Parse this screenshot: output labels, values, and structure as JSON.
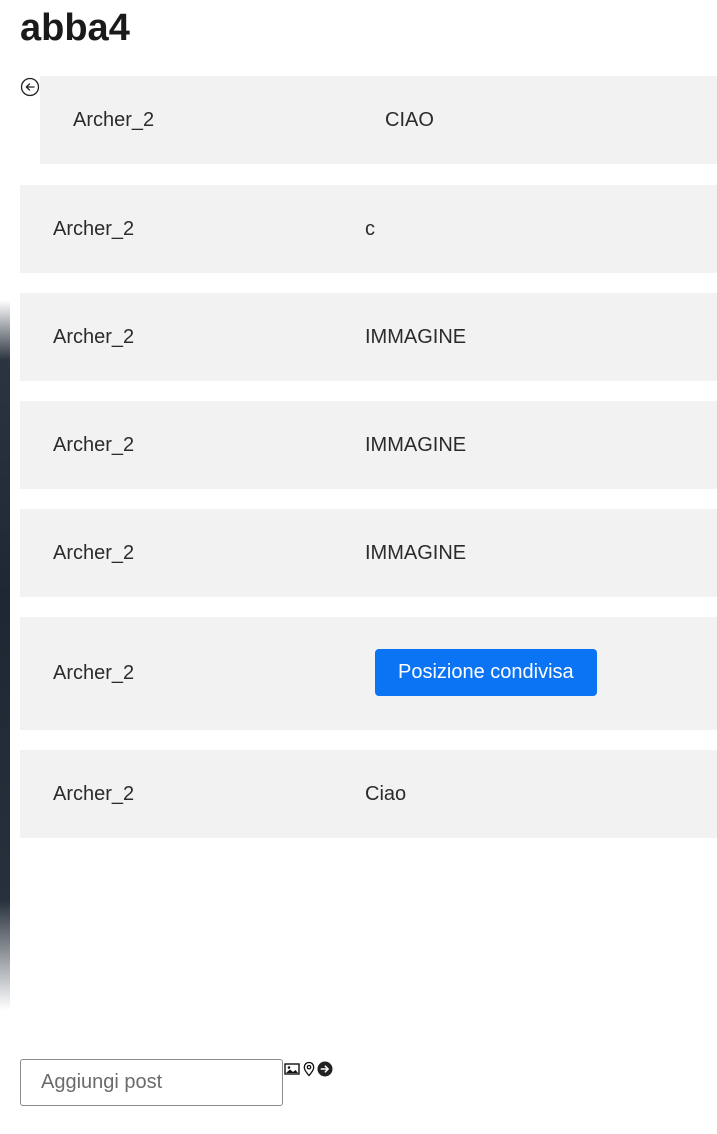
{
  "header": {
    "title": "abba4"
  },
  "messages": [
    {
      "author": "Archer_2",
      "text": "CIAO"
    },
    {
      "author": "Archer_2",
      "text": "c"
    },
    {
      "author": "Archer_2",
      "text": "IMMAGINE"
    },
    {
      "author": "Archer_2",
      "text": "IMMAGINE"
    },
    {
      "author": "Archer_2",
      "text": "IMMAGINE"
    },
    {
      "author": "Archer_2",
      "button_label": "Posizione condivisa"
    },
    {
      "author": "Archer_2",
      "text": "Ciao"
    }
  ],
  "composer": {
    "placeholder": "Aggiungi post",
    "icons": [
      "image-icon",
      "location-pin-icon",
      "send-arrow-icon"
    ]
  },
  "colors": {
    "message_bg": "#f2f2f2",
    "accent": "#0a74f4"
  }
}
